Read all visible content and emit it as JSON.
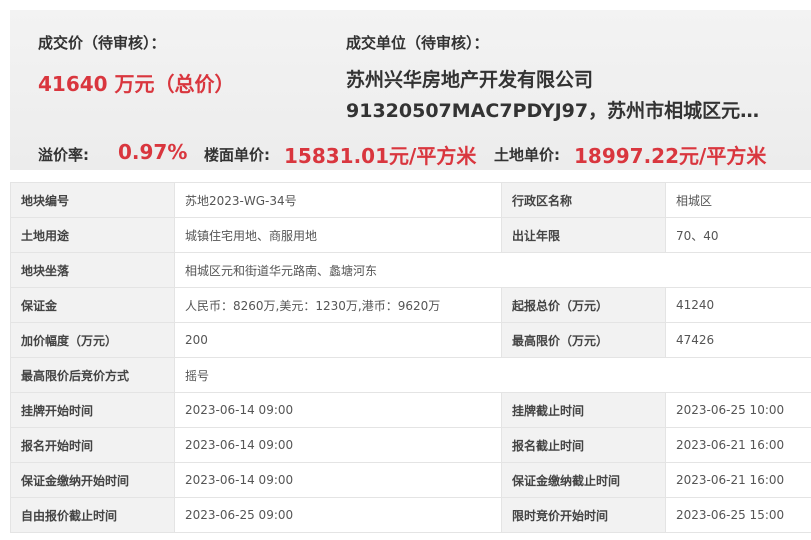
{
  "header": {
    "price_label": "成交价（待审核）：",
    "price_value": "41640 万元（总价）",
    "unit_label": "成交单位（待审核）：",
    "unit_line1": "苏州兴华房地产开发有限公司",
    "unit_line2": "91320507MAC7PDYJ97，苏州市相城区元…",
    "premium_label": "溢价率:",
    "premium_value": "0.97%",
    "floor_price_label": "楼面单价:",
    "floor_price_value": "15831.01元/平方米",
    "land_price_label": "土地单价:",
    "land_price_value": "18997.22元/平方米"
  },
  "table": {
    "rows": [
      {
        "k1": "地块编号",
        "v1": "苏地2023-WG-34号",
        "k2": "行政区名称",
        "v2": "相城区"
      },
      {
        "k1": "土地用途",
        "v1": "城镇住宅用地、商服用地",
        "k2": "出让年限",
        "v2": "70、40"
      },
      {
        "k1": "地块坐落",
        "v1": "相城区元和街道华元路南、蠡塘河东"
      },
      {
        "k1": "保证金",
        "v1": "人民币：8260万,美元：1230万,港币：9620万",
        "k2": "起报总价（万元）",
        "v2": "41240"
      },
      {
        "k1": "加价幅度（万元）",
        "v1": "200",
        "k2": "最高限价（万元）",
        "v2": "47426"
      },
      {
        "k1": "最高限价后竞价方式",
        "v1": "摇号"
      },
      {
        "k1": "挂牌开始时间",
        "v1": "2023-06-14 09:00",
        "k2": "挂牌截止时间",
        "v2": "2023-06-25 10:00"
      },
      {
        "k1": "报名开始时间",
        "v1": "2023-06-14 09:00",
        "k2": "报名截止时间",
        "v2": "2023-06-21 16:00"
      },
      {
        "k1": "保证金缴纳开始时间",
        "v1": "2023-06-14 09:00",
        "k2": "保证金缴纳截止时间",
        "v2": "2023-06-21 16:00"
      },
      {
        "k1": "自由报价截止时间",
        "v1": "2023-06-25 09:00",
        "k2": "限时竞价开始时间",
        "v2": "2023-06-25 15:00"
      }
    ]
  }
}
